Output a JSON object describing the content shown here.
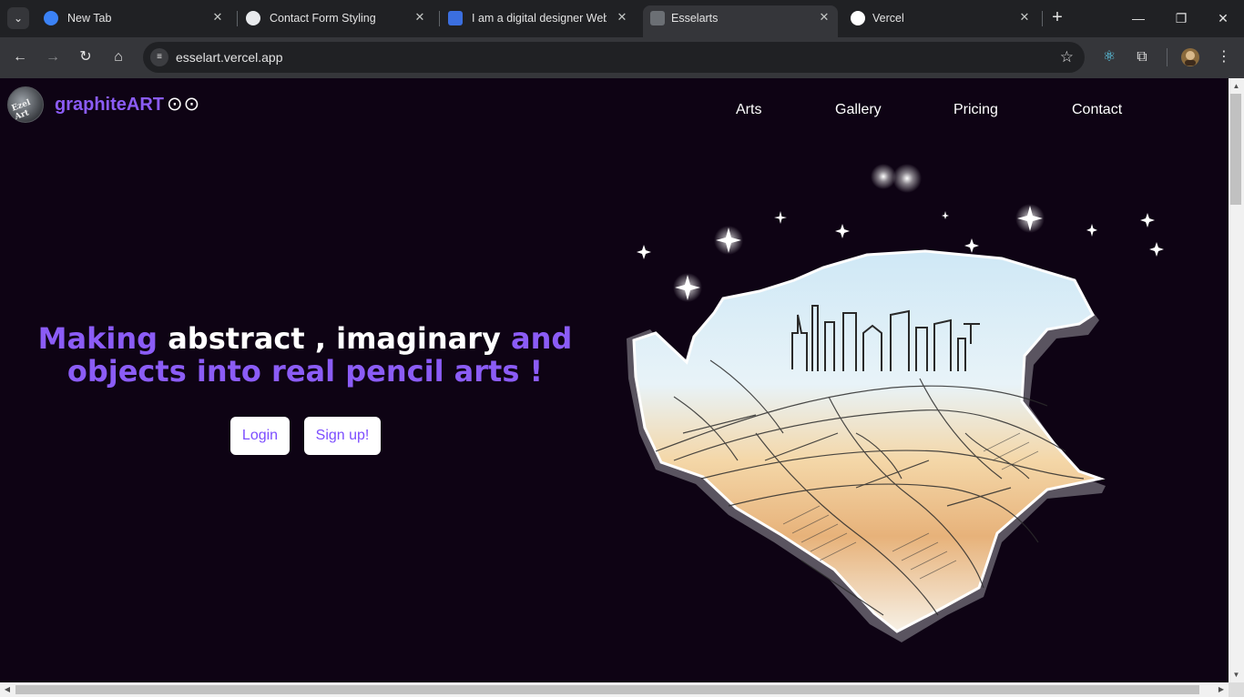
{
  "browser": {
    "tabs": [
      {
        "title": "New Tab",
        "icon": "browser-logo-icon",
        "active": false
      },
      {
        "title": "Contact Form Styling",
        "icon": "chatgpt-icon",
        "active": false
      },
      {
        "title": "I am a digital designer Website",
        "icon": "n-logo-icon",
        "active": false
      },
      {
        "title": "Esselarts",
        "icon": "esselarts-favicon",
        "active": true
      },
      {
        "title": "Vercel",
        "icon": "vercel-triangle-icon",
        "active": false
      }
    ],
    "url": "esselart.vercel.app",
    "close_glyph": "✕",
    "new_tab_glyph": "+"
  },
  "site": {
    "logo_text": "Ezel Art",
    "brand": "graphiteART",
    "brand_suffix": "⊙⊙",
    "nav": [
      "Arts",
      "Gallery",
      "Pricing",
      "Contact"
    ],
    "hero": {
      "word1": "Making",
      "word2": "abstract , imaginary",
      "word3": "and",
      "line2": "objects into real pencil arts !"
    },
    "buttons": {
      "login": "Login",
      "signup": "Sign up!"
    },
    "colors": {
      "accent": "#8b5cf6",
      "background": "#0e0314",
      "text": "#ffffff"
    }
  }
}
